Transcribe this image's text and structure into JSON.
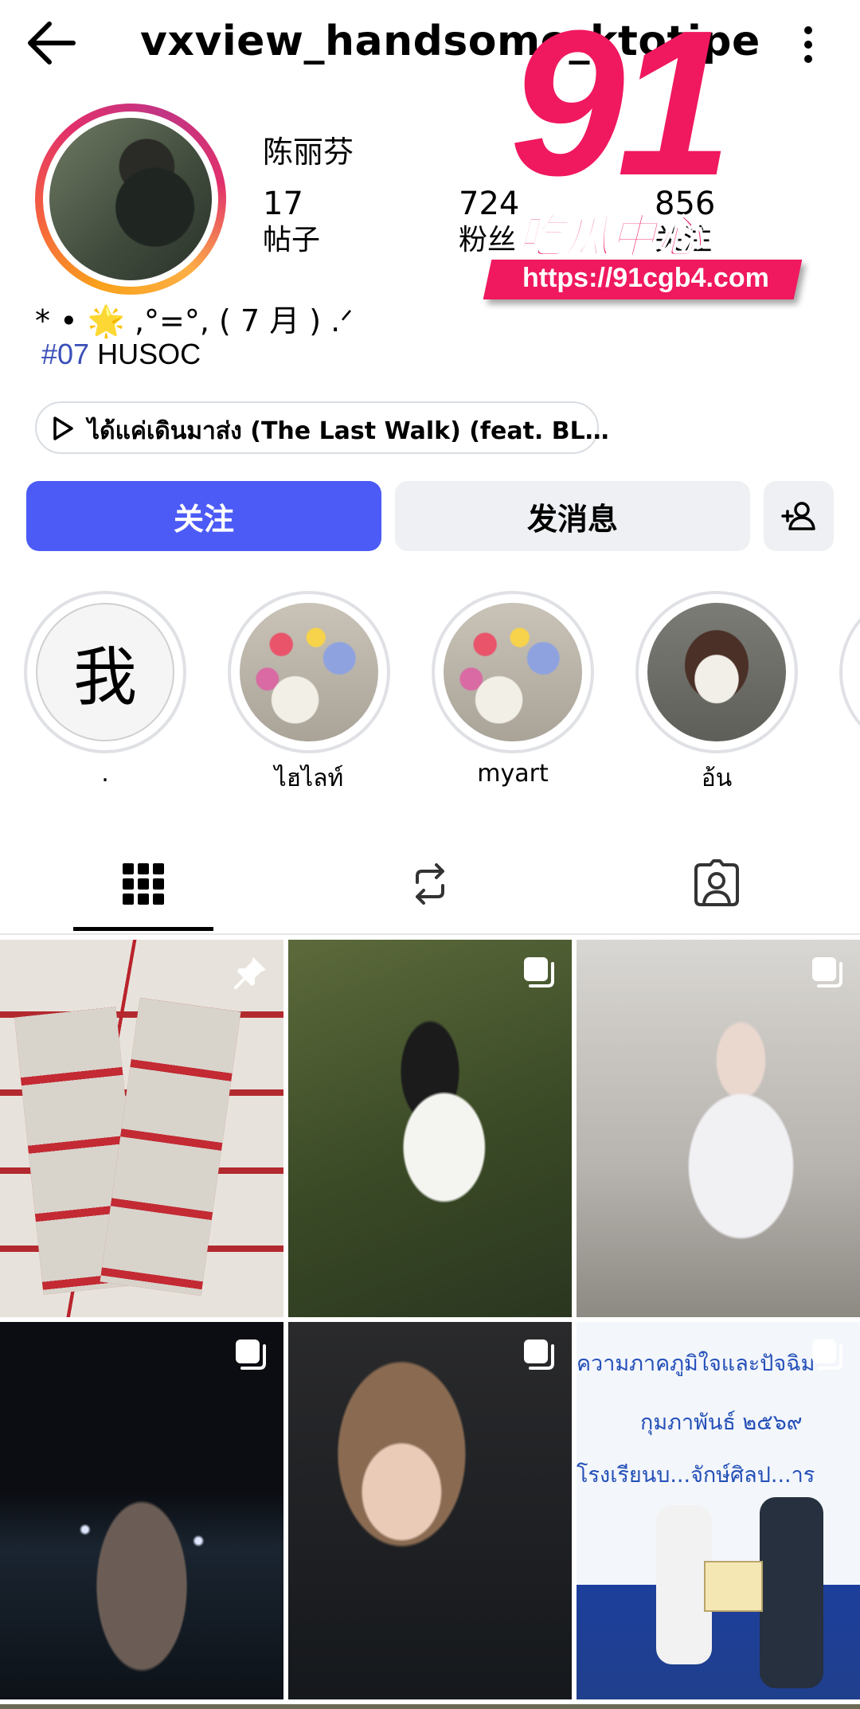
{
  "header": {
    "title": "vxview_handsome_ktotipe"
  },
  "profile": {
    "display_name": "陈丽芬",
    "stats": [
      {
        "value": "17",
        "label": "帖子"
      },
      {
        "value": "724",
        "label": "粉丝"
      },
      {
        "value": "856",
        "label": "关注"
      }
    ],
    "bio_line1": "* • 🌟 ,°=°, ( 7 月 ) .ᐟ",
    "bio_tag": "#07",
    "bio_rest": " HUSOC",
    "music": "ได้แค่เดินมาส่ง (The Last Walk) (feat. BL…"
  },
  "actions": {
    "follow_label": "关注",
    "message_label": "发消息"
  },
  "highlights": [
    {
      "avatar_text": "我",
      "label": "."
    },
    {
      "label": "ไฮไลท์"
    },
    {
      "label": "myart"
    },
    {
      "label": "อ้น"
    }
  ],
  "watermark": {
    "number": "91",
    "subtitle": "吃瓜中心",
    "url": "https://91cgb4.com"
  },
  "posts": {
    "banner_line1": "ความภาคภูมิใจและปัจฉิม",
    "banner_line2": "กุมภาพันธ์ ๒๕๖๙",
    "banner_line3": "โรงเรียนบ...จักษ์ศิลป...าร"
  },
  "colors": {
    "follow_button": "#4c5bf6",
    "secondary_button": "#eef0f3",
    "hashtag": "#3a4fb8",
    "watermark_pink": "#f0185e"
  }
}
